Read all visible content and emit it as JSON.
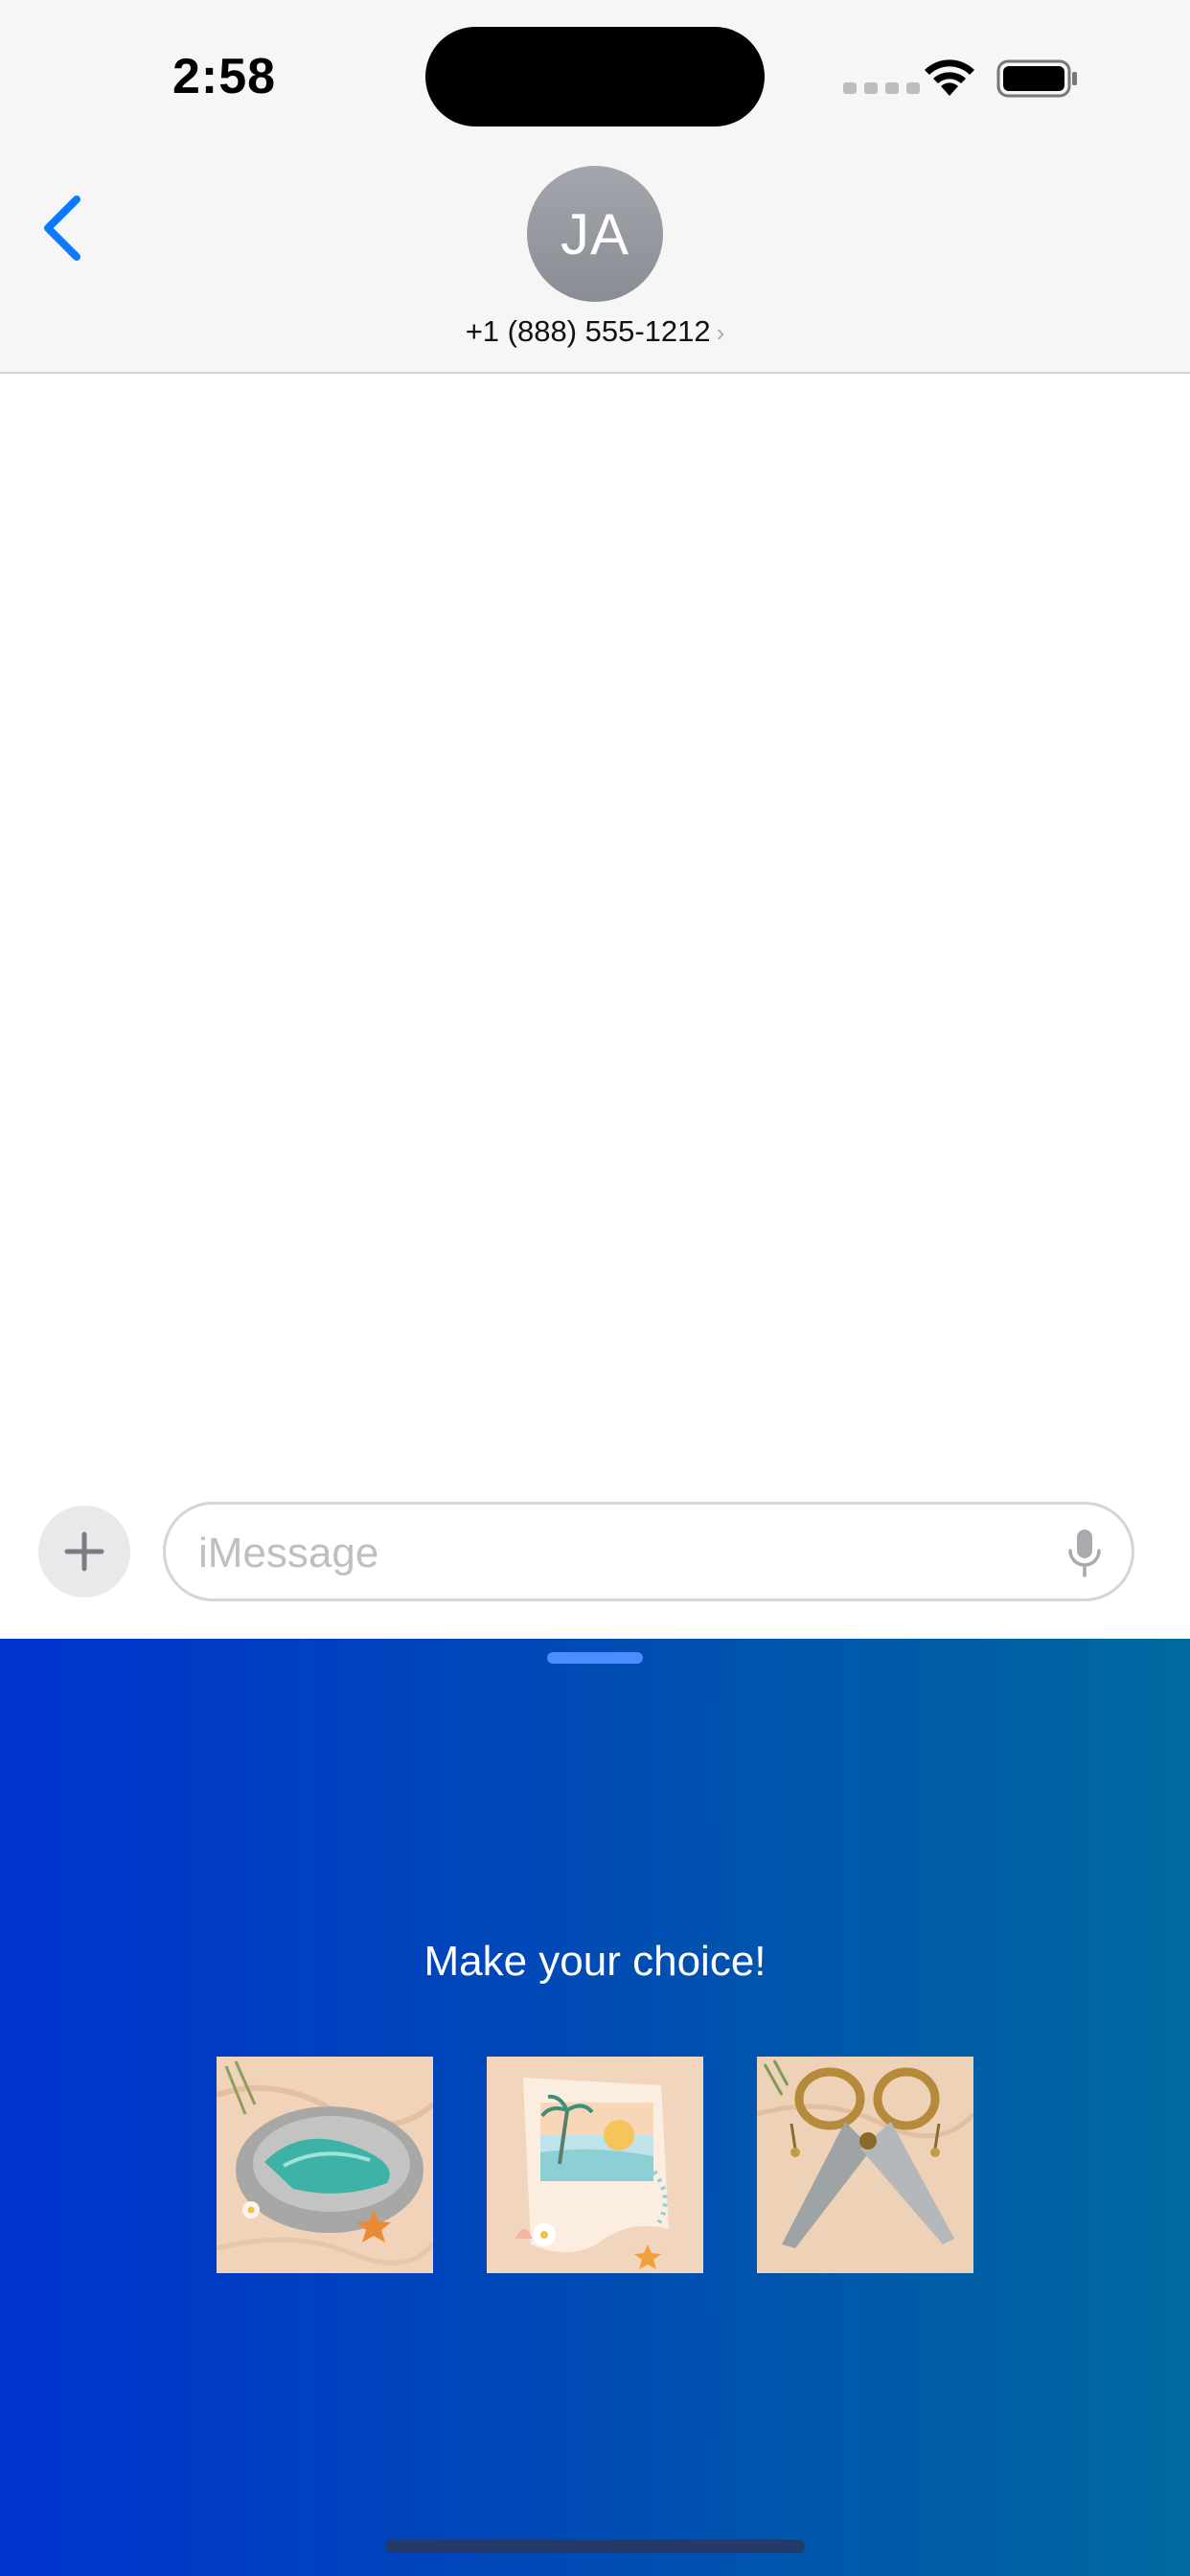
{
  "status_bar": {
    "time": "2:58"
  },
  "header": {
    "avatar_initials": "JA",
    "contact_name": "+1 (888) 555-1212",
    "chevron": "›"
  },
  "composer": {
    "placeholder": "iMessage",
    "plus_icon": "plus-icon",
    "mic_icon": "microphone-icon"
  },
  "game": {
    "prompt": "Make your choice!",
    "choices": [
      {
        "name": "rock"
      },
      {
        "name": "paper"
      },
      {
        "name": "scissors"
      }
    ]
  },
  "colors": {
    "accent": "#0a7aff",
    "panel_start": "#0034cf",
    "panel_end": "#006aa0"
  }
}
